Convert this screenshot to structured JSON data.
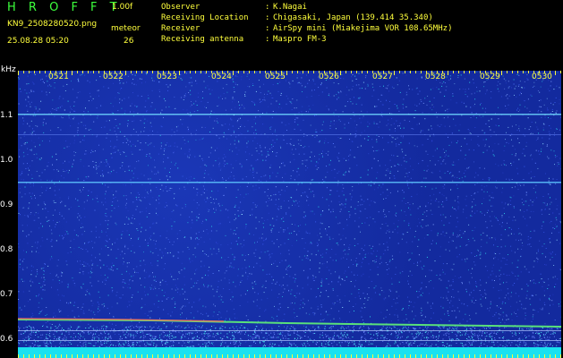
{
  "header": {
    "app_title": "H R O F F T",
    "version": "1.00f",
    "filename": "KN9_2508280520.png",
    "timestamp": "25.08.28 05:20",
    "meteor_label": "meteor",
    "meteor_count": "26"
  },
  "info": [
    {
      "label": "Observer",
      "value": "K.Nagai"
    },
    {
      "label": "Receiving Location",
      "value": "Chigasaki, Japan (139.414 35.340)"
    },
    {
      "label": "Receiver",
      "value": "AirSpy mini (Miakejima VOR 108.65MHz)"
    },
    {
      "label": "Receiving antenna",
      "value": "Maspro FM-3"
    }
  ],
  "axis": {
    "unit": "kHz",
    "y_labels": [
      "1.1",
      "1.0",
      "0.9",
      "0.8",
      "0.7",
      "0.6"
    ],
    "x_labels": [
      "0521",
      "0522",
      "0523",
      "0524",
      "0525",
      "0526",
      "0527",
      "0528",
      "0529",
      "0530"
    ]
  },
  "colors": {
    "background": "#000000",
    "plot_background": "#132a9e",
    "header_green": "#3cff3c",
    "header_yellow": "#ffff3c",
    "text_white": "#ffffff",
    "noise_floor": "#19e1f0"
  }
}
